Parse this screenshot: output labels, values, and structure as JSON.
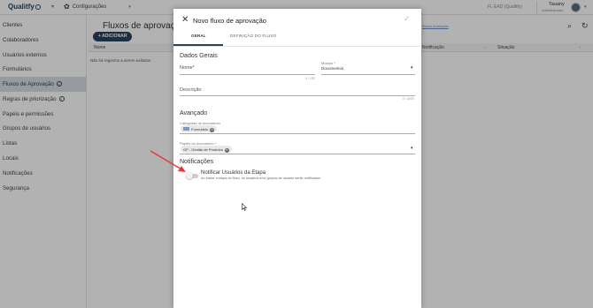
{
  "topbar": {
    "brand": "Qualitfy",
    "module": "Configurações",
    "company": "FL EAD (Qualitfy)",
    "user_name": "Tauany",
    "user_role": "Administrador"
  },
  "sidebar": {
    "items": [
      {
        "label": "Clientes"
      },
      {
        "label": "Colaboradores"
      },
      {
        "label": "Usuários externos"
      },
      {
        "label": "Formulários"
      },
      {
        "label": "Fluxos de Aprovação"
      },
      {
        "label": "Regras de priorização"
      },
      {
        "label": "Papéis e permissões"
      },
      {
        "label": "Grupos de usuários"
      },
      {
        "label": "Listas"
      },
      {
        "label": "Locais"
      },
      {
        "label": "Notificações"
      },
      {
        "label": "Segurança"
      }
    ]
  },
  "main": {
    "title": "Fluxos de aprovação",
    "add_button": "ADICIONAR",
    "search_hint": "Busca Avançada",
    "columns": [
      "Nome",
      "Notificação",
      "Situação"
    ],
    "empty_message": "Não há registros a serem exibidos"
  },
  "dialog": {
    "title": "Novo fluxo de aprovação",
    "tabs": [
      "GERAL",
      "DEFINIÇÃO DO FLUXO"
    ],
    "section_general": "Dados Gerais",
    "name_label": "Nome*",
    "name_counter": "0 / 150",
    "module_label": "Módulo *",
    "module_value": "Documentos",
    "description_label": "Descrição",
    "description_counter": "0 / 4000",
    "section_advanced": "Avançado",
    "categories_label": "Categorias do documento",
    "categories_chip": "Formulário",
    "roles_label": "Papéis do documento *",
    "roles_chip": "GP - Gestão de Produtos",
    "section_notifications": "Notificações",
    "toggle_title": "Notificar Usuários da Etapa",
    "toggle_desc": "Ao iniciar a etapa do fluxo, os usuários e/ou grupos de usuário serão notificados.",
    "toggle_on": false
  },
  "colors": {
    "primary": "#29435c",
    "overlay": "rgba(0,0,0,0.30)",
    "arrow": "#e53935"
  }
}
